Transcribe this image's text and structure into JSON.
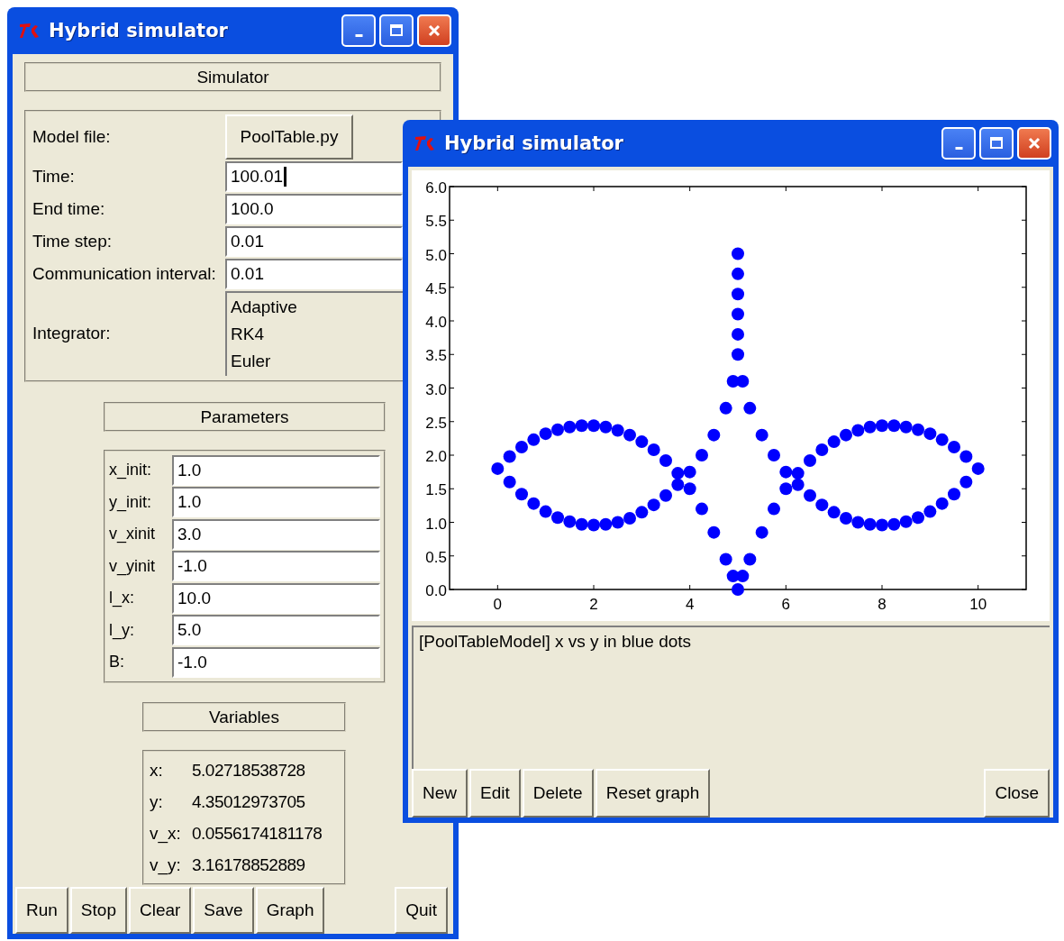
{
  "main_window": {
    "title": "Hybrid simulator",
    "simulator_header": "Simulator",
    "model_file": {
      "label": "Model file:",
      "button": "PoolTable.py"
    },
    "fields": [
      {
        "label": "Time:",
        "value": "100.01",
        "has_cursor": true
      },
      {
        "label": "End time:",
        "value": "100.0",
        "has_cursor": false
      },
      {
        "label": "Time step:",
        "value": "0.01",
        "has_cursor": false
      },
      {
        "label": "Communication interval:",
        "value": "0.01",
        "has_cursor": false
      }
    ],
    "integrator": {
      "label": "Integrator:",
      "options": [
        {
          "label": "Adaptive",
          "selected": false
        },
        {
          "label": "RK4",
          "selected": false
        },
        {
          "label": "Euler",
          "selected": false
        }
      ]
    },
    "parameters_header": "Parameters",
    "parameters": [
      {
        "label": "x_init:",
        "value": "1.0"
      },
      {
        "label": "y_init:",
        "value": "1.0"
      },
      {
        "label": "v_xinit",
        "value": "3.0"
      },
      {
        "label": "v_yinit",
        "value": "-1.0"
      },
      {
        "label": "l_x:",
        "value": "10.0"
      },
      {
        "label": "l_y:",
        "value": "5.0"
      },
      {
        "label": "B:",
        "value": "-1.0"
      }
    ],
    "variables_header": "Variables",
    "variables": [
      {
        "label": "x:",
        "value": "5.02718538728"
      },
      {
        "label": "y:",
        "value": "4.35012973705"
      },
      {
        "label": "v_x:",
        "value": "0.0556174181178"
      },
      {
        "label": "v_y:",
        "value": "3.16178852889"
      }
    ],
    "buttons": [
      "Run",
      "Stop",
      "Clear",
      "Save",
      "Graph"
    ],
    "quit_button": "Quit"
  },
  "graph_window": {
    "title": "Hybrid simulator",
    "chart_data": {
      "type": "scatter",
      "xlim": [
        -1,
        11
      ],
      "ylim": [
        0,
        6
      ],
      "xticks": [
        0,
        2,
        4,
        6,
        8,
        10
      ],
      "yticks": [
        {
          "value": 0,
          "label": "0.0"
        },
        {
          "value": 0.5,
          "label": "0.5"
        },
        {
          "value": 1,
          "label": "1.0"
        },
        {
          "value": 1.5,
          "label": "1.5"
        },
        {
          "value": 2,
          "label": "2.0"
        },
        {
          "value": 2.5,
          "label": "2.5"
        },
        {
          "value": 3,
          "label": "3.0"
        },
        {
          "value": 3.5,
          "label": "3.5"
        },
        {
          "value": 4,
          "label": "4.0"
        },
        {
          "value": 4.5,
          "label": "4.5"
        },
        {
          "value": 5,
          "label": "5.0"
        },
        {
          "value": 5.5,
          "label": "5.5"
        },
        {
          "value": 6,
          "label": "6.0"
        }
      ],
      "x": [
        0,
        0.25,
        0.5,
        0.75,
        1,
        1.25,
        1.5,
        1.75,
        2,
        2.25,
        2.5,
        2.75,
        3,
        3.25,
        3.5,
        3.75,
        4,
        4.25,
        4.5,
        4.75,
        4.9,
        5,
        0.25,
        0.5,
        0.75,
        1,
        1.25,
        1.5,
        1.75,
        2,
        2.25,
        2.5,
        2.75,
        3,
        3.25,
        3.5,
        3.75,
        4,
        4.25,
        4.5,
        4.75,
        4.9,
        5,
        5,
        5,
        5,
        5,
        5,
        10,
        9.75,
        9.5,
        9.25,
        9,
        8.75,
        8.5,
        8.25,
        8,
        7.75,
        7.5,
        7.25,
        7,
        6.75,
        6.5,
        6.25,
        6,
        5.75,
        5.5,
        5.25,
        5.1,
        9.75,
        9.5,
        9.25,
        9,
        8.75,
        8.5,
        8.25,
        8,
        7.75,
        7.5,
        7.25,
        7,
        6.75,
        6.5,
        6.25,
        6,
        5.75,
        5.5,
        5.25,
        5.1
      ],
      "series": [
        {
          "color": "#0000ff",
          "values": [
            1.8,
            1.98,
            2.12,
            2.23,
            2.32,
            2.38,
            2.42,
            2.44,
            2.44,
            2.42,
            2.37,
            2.3,
            2.2,
            2.08,
            1.92,
            1.73,
            1.5,
            1.2,
            0.85,
            0.45,
            0.2,
            0,
            1.6,
            1.42,
            1.28,
            1.16,
            1.07,
            1.01,
            0.97,
            0.96,
            0.97,
            1.0,
            1.06,
            1.15,
            1.26,
            1.4,
            1.56,
            1.75,
            2.0,
            2.3,
            2.7,
            3.1,
            3.5,
            3.8,
            4.1,
            4.4,
            4.7,
            5.0,
            1.8,
            1.98,
            2.12,
            2.23,
            2.32,
            2.38,
            2.42,
            2.44,
            2.44,
            2.42,
            2.37,
            2.3,
            2.2,
            2.08,
            1.92,
            1.73,
            1.5,
            1.2,
            0.85,
            0.45,
            0.2,
            1.6,
            1.42,
            1.28,
            1.16,
            1.07,
            1.01,
            0.97,
            0.96,
            0.97,
            1.0,
            1.06,
            1.15,
            1.26,
            1.4,
            1.56,
            1.75,
            2.0,
            2.3,
            2.7,
            3.1
          ]
        }
      ]
    },
    "log": "[PoolTableModel] x vs y in blue dots",
    "buttons": [
      "New",
      "Edit",
      "Delete",
      "Reset graph"
    ],
    "close_button": "Close"
  }
}
